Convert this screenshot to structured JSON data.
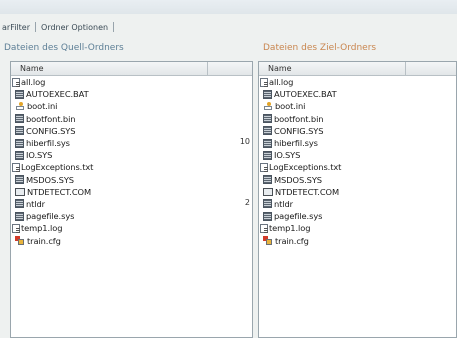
{
  "tabs": [
    "arFilter",
    "Ordner Optionen"
  ],
  "source": {
    "title": "Dateien des Quell-Ordners",
    "column_name": "Name",
    "files": [
      {
        "name": "all.log",
        "icon": "text-file-icon"
      },
      {
        "name": "AUTOEXEC.BAT",
        "icon": "binary-file-icon"
      },
      {
        "name": "boot.ini",
        "icon": "ini-file-icon"
      },
      {
        "name": "bootfont.bin",
        "icon": "binary-file-icon"
      },
      {
        "name": "CONFIG.SYS",
        "icon": "binary-file-icon"
      },
      {
        "name": "hiberfil.sys",
        "icon": "binary-file-icon"
      },
      {
        "name": "IO.SYS",
        "icon": "binary-file-icon"
      },
      {
        "name": "LogExceptions.txt",
        "icon": "text-file-icon"
      },
      {
        "name": "MSDOS.SYS",
        "icon": "binary-file-icon"
      },
      {
        "name": "NTDETECT.COM",
        "icon": "com-file-icon"
      },
      {
        "name": "ntldr",
        "icon": "binary-file-icon"
      },
      {
        "name": "pagefile.sys",
        "icon": "binary-file-icon"
      },
      {
        "name": "temp1.log",
        "icon": "text-file-icon"
      },
      {
        "name": "train.cfg",
        "icon": "cfg-file-icon"
      }
    ],
    "sizes": [
      {
        "row": 5,
        "value": "10"
      },
      {
        "row": 10,
        "value": "2"
      }
    ]
  },
  "target": {
    "title": "Dateien des Ziel-Ordners",
    "column_name": "Name",
    "files": [
      {
        "name": "all.log",
        "icon": "text-file-icon"
      },
      {
        "name": "AUTOEXEC.BAT",
        "icon": "binary-file-icon"
      },
      {
        "name": "boot.ini",
        "icon": "ini-file-icon"
      },
      {
        "name": "bootfont.bin",
        "icon": "binary-file-icon"
      },
      {
        "name": "CONFIG.SYS",
        "icon": "binary-file-icon"
      },
      {
        "name": "hiberfil.sys",
        "icon": "binary-file-icon"
      },
      {
        "name": "IO.SYS",
        "icon": "binary-file-icon"
      },
      {
        "name": "LogExceptions.txt",
        "icon": "text-file-icon"
      },
      {
        "name": "MSDOS.SYS",
        "icon": "binary-file-icon"
      },
      {
        "name": "NTDETECT.COM",
        "icon": "com-file-icon"
      },
      {
        "name": "ntldr",
        "icon": "binary-file-icon"
      },
      {
        "name": "pagefile.sys",
        "icon": "binary-file-icon"
      },
      {
        "name": "temp1.log",
        "icon": "text-file-icon"
      },
      {
        "name": "train.cfg",
        "icon": "cfg-file-icon"
      }
    ]
  },
  "colors": {
    "source_title": "#5d7f96",
    "target_title": "#c9864f"
  }
}
